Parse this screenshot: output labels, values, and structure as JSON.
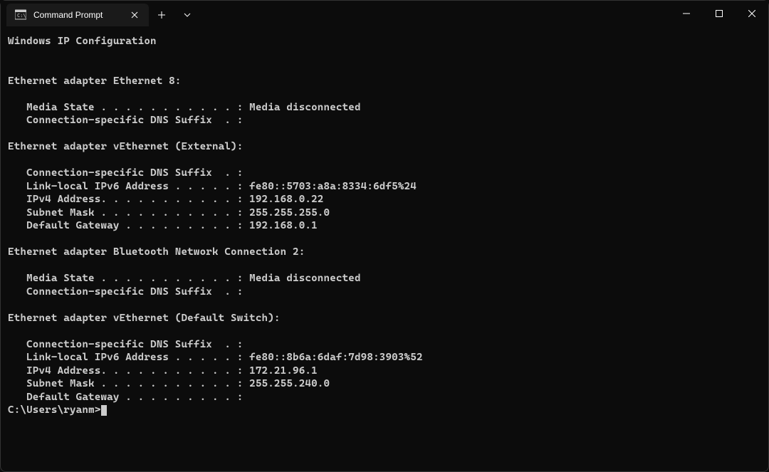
{
  "titlebar": {
    "tab_title": "Command Prompt"
  },
  "output": {
    "header": "Windows IP Configuration",
    "adapters": [
      {
        "name": "Ethernet adapter Ethernet 8:",
        "lines": [
          "   Media State . . . . . . . . . . . : Media disconnected",
          "   Connection-specific DNS Suffix  . :"
        ]
      },
      {
        "name": "Ethernet adapter vEthernet (External):",
        "lines": [
          "   Connection-specific DNS Suffix  . :",
          "   Link-local IPv6 Address . . . . . : fe80::5703:a8a:8334:6df5%24",
          "   IPv4 Address. . . . . . . . . . . : 192.168.0.22",
          "   Subnet Mask . . . . . . . . . . . : 255.255.255.0",
          "   Default Gateway . . . . . . . . . : 192.168.0.1"
        ]
      },
      {
        "name": "Ethernet adapter Bluetooth Network Connection 2:",
        "lines": [
          "   Media State . . . . . . . . . . . : Media disconnected",
          "   Connection-specific DNS Suffix  . :"
        ]
      },
      {
        "name": "Ethernet adapter vEthernet (Default Switch):",
        "lines": [
          "   Connection-specific DNS Suffix  . :",
          "   Link-local IPv6 Address . . . . . : fe80::8b6a:6daf:7d98:3903%52",
          "   IPv4 Address. . . . . . . . . . . : 172.21.96.1",
          "   Subnet Mask . . . . . . . . . . . : 255.255.240.0",
          "   Default Gateway . . . . . . . . . :"
        ]
      }
    ],
    "prompt": "C:\\Users\\ryanm>"
  }
}
